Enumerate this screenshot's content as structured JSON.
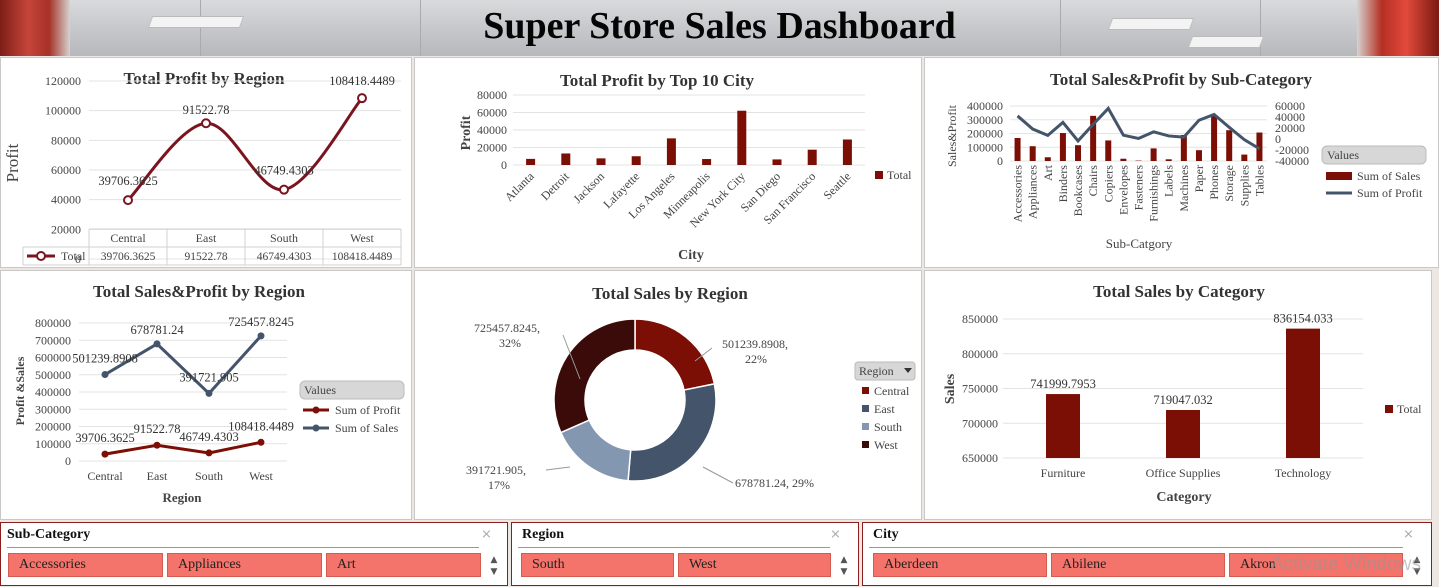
{
  "dashboard": {
    "title": "Super Store Sales Dashboard"
  },
  "profit_by_region": {
    "title": "Total Profit by Region",
    "ylabel": "Profit",
    "yticks": [
      "120000",
      "100000",
      "80000",
      "60000",
      "40000",
      "20000",
      "0"
    ],
    "legend": "Total",
    "color": "#7a1520"
  },
  "top_city": {
    "title": "Total Profit by Top 10 City",
    "ylabel": "Profit",
    "xlabel": "City",
    "yticks": [
      "80000",
      "60000",
      "40000",
      "20000",
      "0"
    ],
    "legend": "Total",
    "color": "#7b0e05"
  },
  "subcat": {
    "title": "Total Sales&Profit by Sub-Category",
    "ylabel": "Sales&Profit",
    "xlabel": "Sub-Catgory",
    "yticks_left": [
      "400000",
      "300000",
      "200000",
      "100000",
      "0"
    ],
    "yticks_right": [
      "60000",
      "40000",
      "20000",
      "0",
      "-20000",
      "-40000"
    ],
    "legend_header": "Values",
    "legend": [
      "Sum of Sales",
      "Sum of Profit"
    ],
    "colors": {
      "sales": "#7b0e05",
      "profit": "#44546a"
    }
  },
  "sp_region": {
    "title": "Total Sales&Profit by Region",
    "ylabel": "Profit &Sales",
    "xlabel": "Region",
    "yticks": [
      "800000",
      "700000",
      "600000",
      "500000",
      "400000",
      "300000",
      "200000",
      "100000",
      "0"
    ],
    "legend_header": "Values",
    "legend": [
      "Sum of Profit",
      "Sum of Sales"
    ],
    "colors": {
      "profit": "#7b0e05",
      "sales": "#44546a"
    }
  },
  "sales_region": {
    "title": "Total Sales by Region",
    "legend_header": "Region",
    "legend": [
      "Central",
      "East",
      "South",
      "West"
    ],
    "colors": [
      "#7b0e05",
      "#44546a",
      "#8497b0",
      "#3a0b08"
    ]
  },
  "sales_category": {
    "title": "Total Sales by Category",
    "ylabel": "Sales",
    "xlabel": "Category",
    "yticks": [
      "850000",
      "800000",
      "750000",
      "700000",
      "650000"
    ],
    "legend": "Total",
    "color": "#7b0e05"
  },
  "chart_data": [
    {
      "type": "line",
      "title": "Total Profit by Region",
      "categories": [
        "Central",
        "East",
        "South",
        "West"
      ],
      "series": [
        {
          "name": "Total",
          "values": [
            39706.3625,
            91522.78,
            46749.4303,
            108418.4489
          ]
        }
      ],
      "labels": [
        "39706.3625",
        "91522.78",
        "46749.4303",
        "108418.4489"
      ],
      "ylim": [
        0,
        120000
      ]
    },
    {
      "type": "bar",
      "title": "Total Profit by Top 10 City",
      "categories": [
        "Atlanta",
        "Detroit",
        "Jackson",
        "Lafayette",
        "Los Angeles",
        "Minneapolis",
        "New York City",
        "San Diego",
        "San Francisco",
        "Seattle"
      ],
      "series": [
        {
          "name": "Total",
          "values": [
            6994,
            13181,
            7581,
            10018,
            30440,
            6824,
            62037,
            6378,
            17507,
            29156
          ]
        }
      ],
      "ylim": [
        0,
        80000
      ]
    },
    {
      "type": "line",
      "title": "Total Sales&Profit by Sub-Category",
      "categories": [
        "Accessories",
        "Appliances",
        "Art",
        "Binders",
        "Bookcases",
        "Chairs",
        "Copiers",
        "Envelopes",
        "Fasteners",
        "Furnishings",
        "Labels",
        "Machines",
        "Paper",
        "Phones",
        "Storage",
        "Supplies",
        "Tables"
      ],
      "series": [
        {
          "name": "Sum of Sales",
          "values": [
            167380,
            107532,
            27119,
            203413,
            114880,
            328449,
            149528,
            16476,
            3024,
            91705,
            12486,
            189239,
            78479,
            330007,
            223844,
            46674,
            206966
          ]
        },
        {
          "name": "Sum of Profit",
          "values": [
            41937,
            18138,
            6528,
            30222,
            -3473,
            26590,
            55618,
            6964,
            950,
            13059,
            5546,
            3385,
            34054,
            44516,
            21279,
            -1189,
            -17725
          ]
        }
      ],
      "ylim_left": [
        0,
        400000
      ],
      "ylim_right": [
        -40000,
        60000
      ]
    },
    {
      "type": "line",
      "title": "Total Sales&Profit by Region",
      "categories": [
        "Central",
        "East",
        "South",
        "West"
      ],
      "series": [
        {
          "name": "Sum of Profit",
          "values": [
            39706.3625,
            91522.78,
            46749.4303,
            108418.4489
          ],
          "labels": [
            "39706.3625",
            "91522.78",
            "46749.4303",
            "108418.4489"
          ]
        },
        {
          "name": "Sum of Sales",
          "values": [
            501239.8908,
            678781.24,
            391721.905,
            725457.8245
          ],
          "labels": [
            "501239.8908",
            "678781.24",
            "391721.905",
            "725457.8245"
          ]
        }
      ],
      "ylim": [
        0,
        800000
      ]
    },
    {
      "type": "pie",
      "title": "Total Sales by Region",
      "categories": [
        "Central",
        "East",
        "South",
        "West"
      ],
      "values": [
        501239.8908,
        678781.24,
        391721.905,
        725457.8245
      ],
      "labels": [
        "501239.8908,",
        "22%",
        "678781.24, 29%",
        "391721.905,",
        "17%",
        "725457.8245,",
        "32%"
      ]
    },
    {
      "type": "bar",
      "title": "Total Sales by Category",
      "categories": [
        "Furniture",
        "Office Supplies",
        "Technology"
      ],
      "series": [
        {
          "name": "Total",
          "values": [
            741999.7953,
            719047.032,
            836154.033
          ]
        }
      ],
      "labels": [
        "741999.7953",
        "719047.032",
        "836154.033"
      ],
      "ylim": [
        650000,
        850000
      ]
    }
  ],
  "slicers": [
    {
      "header": "Sub-Category",
      "items": [
        "Accessories",
        "Appliances",
        "Art"
      ]
    },
    {
      "header": "Region",
      "items": [
        "South",
        "West"
      ]
    },
    {
      "header": "City",
      "items": [
        "Aberdeen",
        "Abilene",
        "Akron"
      ]
    }
  ],
  "watermark": "Activate Windows"
}
